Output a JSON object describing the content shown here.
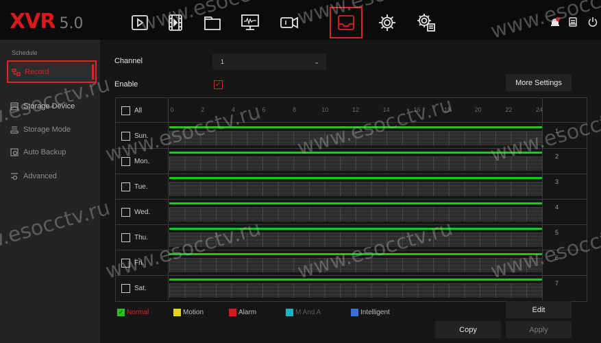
{
  "app": {
    "logo": "XVR",
    "version": "5.0"
  },
  "topnav": [
    {
      "icon": "playback-icon"
    },
    {
      "icon": "video-clip-icon"
    },
    {
      "icon": "folder-icon"
    },
    {
      "icon": "monitor-icon"
    },
    {
      "icon": "camera-icon"
    },
    {
      "icon": "storage-icon",
      "active": true
    },
    {
      "icon": "settings-icon"
    },
    {
      "icon": "system-icon"
    }
  ],
  "topright": {
    "icons": [
      "alarm-icon",
      "notes-icon",
      "power-icon"
    ]
  },
  "sidebar": {
    "header": "Schedule",
    "items": [
      {
        "label": "Record",
        "icon": "record-icon",
        "active": true
      },
      {
        "label": "Storage Device",
        "icon": "hdd-icon"
      },
      {
        "label": "Storage Mode",
        "icon": "storage-mode-icon"
      },
      {
        "label": "Auto Backup",
        "icon": "backup-icon"
      },
      {
        "label": "Advanced",
        "icon": "advanced-icon"
      }
    ]
  },
  "form": {
    "channel_label": "Channel",
    "channel_value": "1",
    "enable_label": "Enable",
    "enable_checked": true,
    "more_settings": "More Settings"
  },
  "schedule": {
    "all_label": "All",
    "hour_labels": [
      "0",
      "2",
      "4",
      "6",
      "8",
      "10",
      "12",
      "14",
      "16",
      "18",
      "20",
      "22",
      "24"
    ],
    "days": [
      {
        "label": "Sun.",
        "number": "1"
      },
      {
        "label": "Mon.",
        "number": "2"
      },
      {
        "label": "Tue.",
        "number": "3"
      },
      {
        "label": "Wed.",
        "number": "4"
      },
      {
        "label": "Thu.",
        "number": "5"
      },
      {
        "label": "Fri.",
        "number": "6"
      },
      {
        "label": "Sat.",
        "number": "7"
      }
    ],
    "normal_coverage": 1.0
  },
  "legend": [
    {
      "label": "Normal",
      "color": "#22c61a",
      "checked": true,
      "text_color": "#e02424"
    },
    {
      "label": "Motion",
      "color": "#e8d21a",
      "text_color": "#bdbdbd"
    },
    {
      "label": "Alarm",
      "color": "#d81a1a",
      "text_color": "#bdbdbd"
    },
    {
      "label": "M And A",
      "color": "#18b6c2",
      "text_color": "#5a5a5a"
    },
    {
      "label": "Intelligent",
      "color": "#3a6fd8",
      "text_color": "#bdbdbd"
    }
  ],
  "buttons": {
    "edit": "Edit",
    "copy": "Copy",
    "apply": "Apply"
  },
  "watermark": "www.esocctv.ru",
  "colors": {
    "accent": "#e02424",
    "schedule_normal": "#22c61a"
  }
}
